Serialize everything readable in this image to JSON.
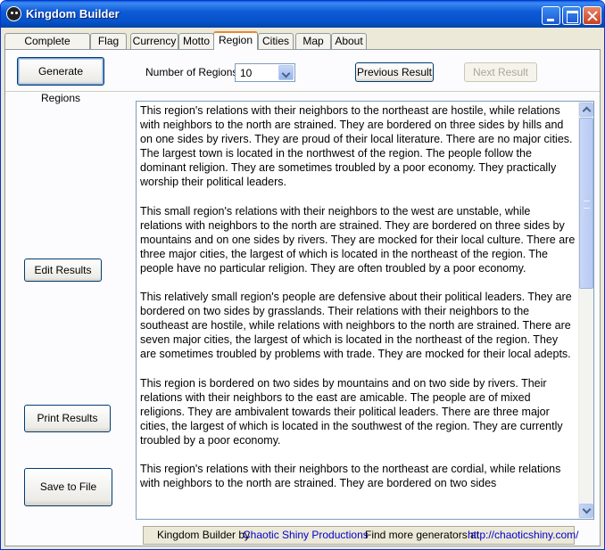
{
  "window": {
    "title": "Kingdom Builder"
  },
  "tabs": [
    {
      "label": "Complete Kingdom"
    },
    {
      "label": "Flag"
    },
    {
      "label": "Currency"
    },
    {
      "label": "Motto"
    },
    {
      "label": "Region"
    },
    {
      "label": "Cities"
    },
    {
      "label": "Map"
    },
    {
      "label": "About"
    }
  ],
  "active_tab": "Region",
  "toolbar": {
    "generate_label": "Generate Regions",
    "num_regions_label": "Number of Regions:",
    "num_regions_value": "10",
    "previous_label": "Previous Result",
    "next_label": "Next Result"
  },
  "side_buttons": {
    "edit_label": "Edit Results",
    "print_label": "Print Results",
    "save_label": "Save to File"
  },
  "results": [
    "This  region's  relations with their neighbors to the northeast are hostile, while relations with neighbors to the north are strained. They are  bordered on three sides by hills and on one sides by rivers. They are  proud of their local literature. There are no major cities. The largest town is located in the northwest of the region. The people follow the dominant religion. They are sometimes troubled by a poor economy. They practically worship their political leaders.",
    "This small region's  relations with their neighbors to the west are unstable, while relations with neighbors to the north are strained. They are  bordered on three sides by mountains and on one sides by rivers. They are  mocked for their local culture. There are three major cities, the largest of which is located in the northeast of the region. The people have no particular religion. They are often troubled by a poor economy.",
    "This relatively small region's people are defensive about their political leaders. They are  bordered on two sides by grasslands. Their  relations with their neighbors to the southeast are hostile, while relations with neighbors to the north are strained. There are seven major cities, the largest of which is located in the northeast of the region. They are sometimes troubled by problems with trade. They are  mocked for their local adepts.",
    "This  region is bordered on two sides by mountains and on two side by rivers. Their relations with their neighbors to the east are amicable. The people are of mixed religions. They are ambivalent towards their political leaders. There are three major cities, the largest of which is located in the southwest of the region. They are currently troubled by a poor economy.",
    "This  region's  relations with their neighbors to the northeast are cordial, while relations with neighbors to the north are strained. They are  bordered on two sides"
  ],
  "footer": {
    "app_name": "Kingdom Builder by",
    "author": "Chaotic Shiny Productions",
    "more_text": "Find more generators at",
    "url": "http://chaoticshiny.com/"
  },
  "colors": {
    "titlebar": "#0A5FD8",
    "tab_highlight": "#E68B2C",
    "link": "#0000CC"
  }
}
